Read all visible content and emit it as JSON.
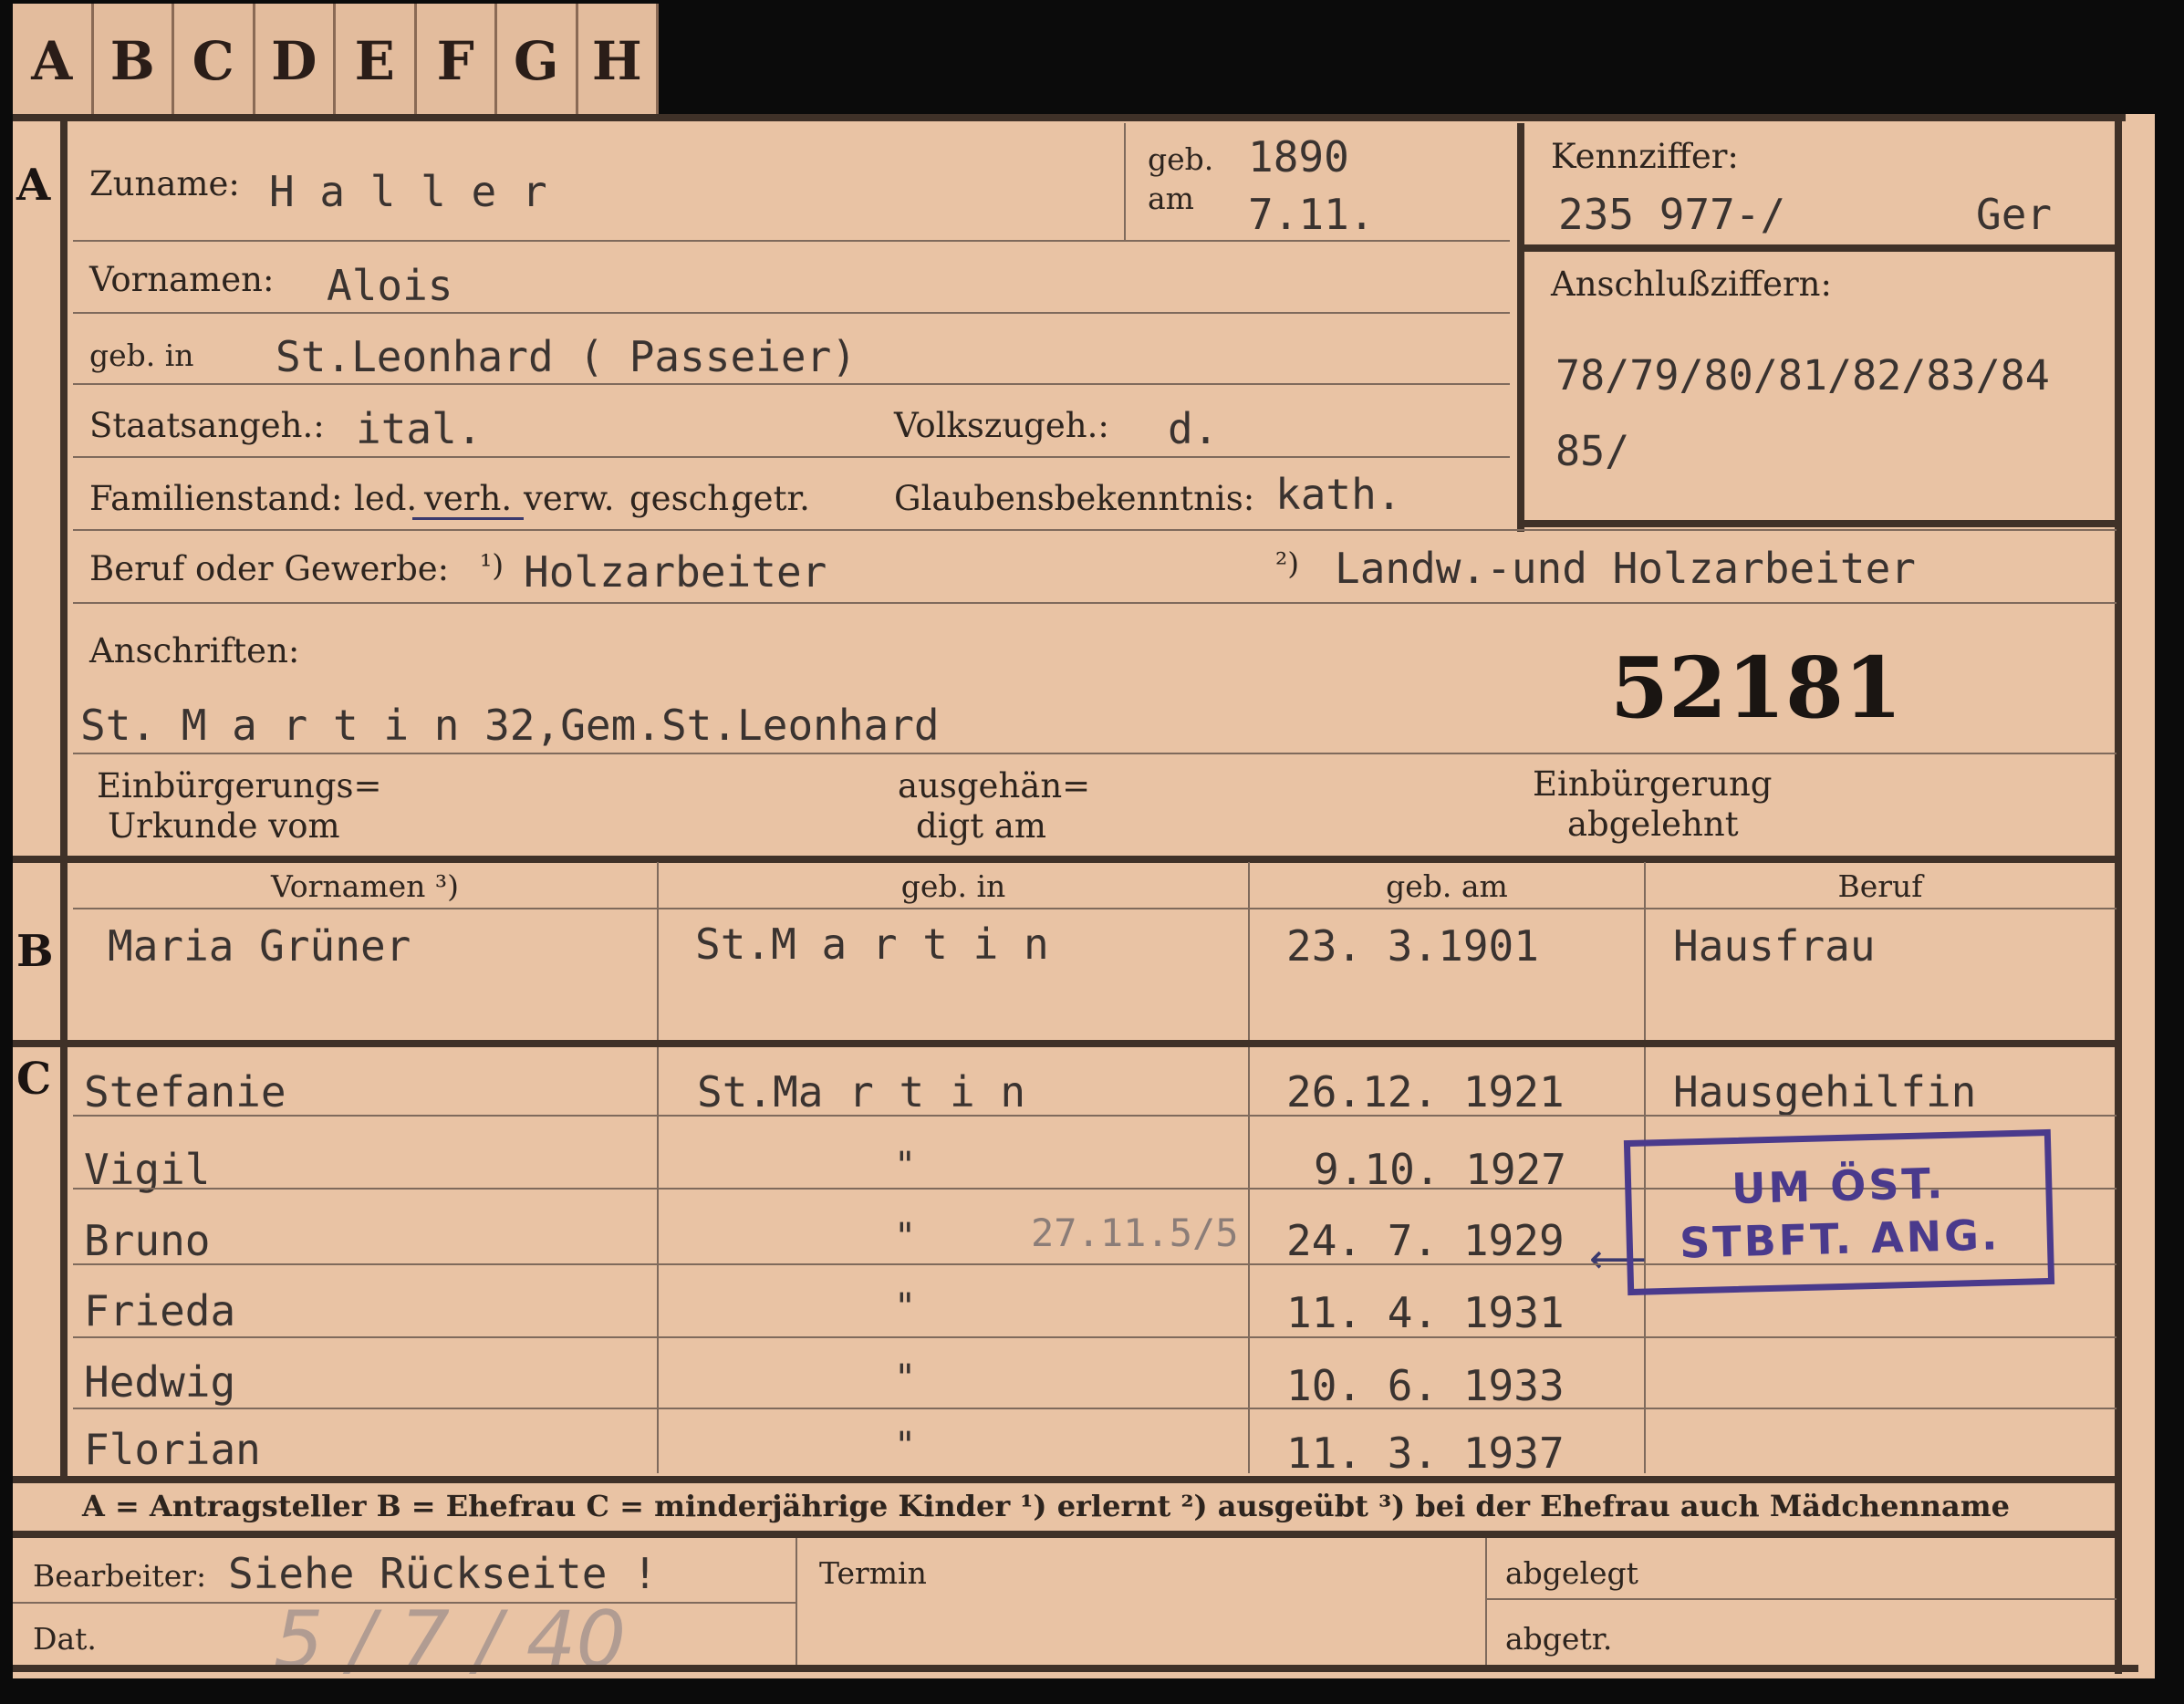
{
  "tabs": [
    "A",
    "B",
    "C",
    "D",
    "E",
    "F",
    "G",
    "H"
  ],
  "sections": {
    "a": "A",
    "b": "B",
    "c": "C"
  },
  "person": {
    "surname_label": "Zuname:",
    "surname": "H a l l e r",
    "born_label_1": "geb.",
    "born_label_2": "am",
    "birth_year": "1890",
    "birth_date": "7.11.",
    "firstnames_label": "Vornamen:",
    "firstnames": "Alois",
    "birthplace_label": "geb. in",
    "birthplace": "St.Leonhard ( Passeier)",
    "citizenship_label": "Staatsangeh.:",
    "citizenship": "ital.",
    "ethnicity_label": "Volkszugeh.:",
    "ethnicity": "d.",
    "marital_label": "Familienstand:",
    "marital_options": [
      "led.",
      "verh.",
      "verw.",
      "gesch.",
      "getr."
    ],
    "religion_label": "Glaubensbekenntnis:",
    "religion": "kath.",
    "occupation_label": "Beruf oder Gewerbe:",
    "occ1_marker": "¹)",
    "occupation_1": "Holzarbeiter",
    "occ2_marker": "²)",
    "occupation_2": "Landw.-und Holzarbeiter",
    "address_label": "Anschriften:",
    "address": "St. M a r t i n 32,Gem.St.Leonhard",
    "file_number": "52181",
    "naturalization_cert_label_1": "Einbürgerungs=",
    "naturalization_cert_label_2": "Urkunde vom",
    "handed_label_1": "ausgehän=",
    "handed_label_2": "digt am",
    "naturalization_denied_label_1": "Einbürgerung",
    "naturalization_denied_label_2": "abgelehnt"
  },
  "ids": {
    "kennziffer_label": "Kennziffer:",
    "kennziffer": "235 977-/",
    "kennziffer_suffix": "Ger",
    "anschluss_label": "Anschlußziffern:",
    "anschluss_line1": "78/79/80/81/82/83/84",
    "anschluss_line2": "85/"
  },
  "wife_table": {
    "headers": [
      "Vornamen ³)",
      "geb. in",
      "geb. am",
      "Beruf"
    ],
    "name": "Maria Grüner",
    "place": "St.M a r t i n",
    "date": "23. 3.1901",
    "occupation": "Hausfrau"
  },
  "children": [
    {
      "name": "Stefanie",
      "place": "St.Ma r t i n",
      "date": "26.12. 1921",
      "occupation": "Hausgehilfin"
    },
    {
      "name": "Vigil",
      "place": "\"",
      "date": "9.10. 1927",
      "occupation": ""
    },
    {
      "name": "Bruno",
      "place": "\"",
      "date": "24. 7. 1929",
      "occupation": ""
    },
    {
      "name": "Frieda",
      "place": "\"",
      "date": "11. 4. 1931",
      "occupation": ""
    },
    {
      "name": "Hedwig",
      "place": "\"",
      "date": "10. 6. 1933",
      "occupation": ""
    },
    {
      "name": "Florian",
      "place": "\"",
      "date": "11. 3. 1937",
      "occupation": ""
    }
  ],
  "annotation": "27.11.5/5",
  "stamp": {
    "line1": "UM ÖST.",
    "line2": "STBFT. ANG."
  },
  "legend": "A = Antragsteller   B = Ehefrau   C = minderjährige Kinder   ¹) erlernt   ²) ausgeübt   ³) bei der Ehefrau auch Mädchenname",
  "footer": {
    "processor_label": "Bearbeiter:",
    "processor_value": "Siehe Rückseite !",
    "date_label": "Dat.",
    "date_value": "5 / 7 / 40",
    "termin_label": "Termin",
    "filed_label": "abgelegt",
    "separated_label": "abgetr."
  }
}
